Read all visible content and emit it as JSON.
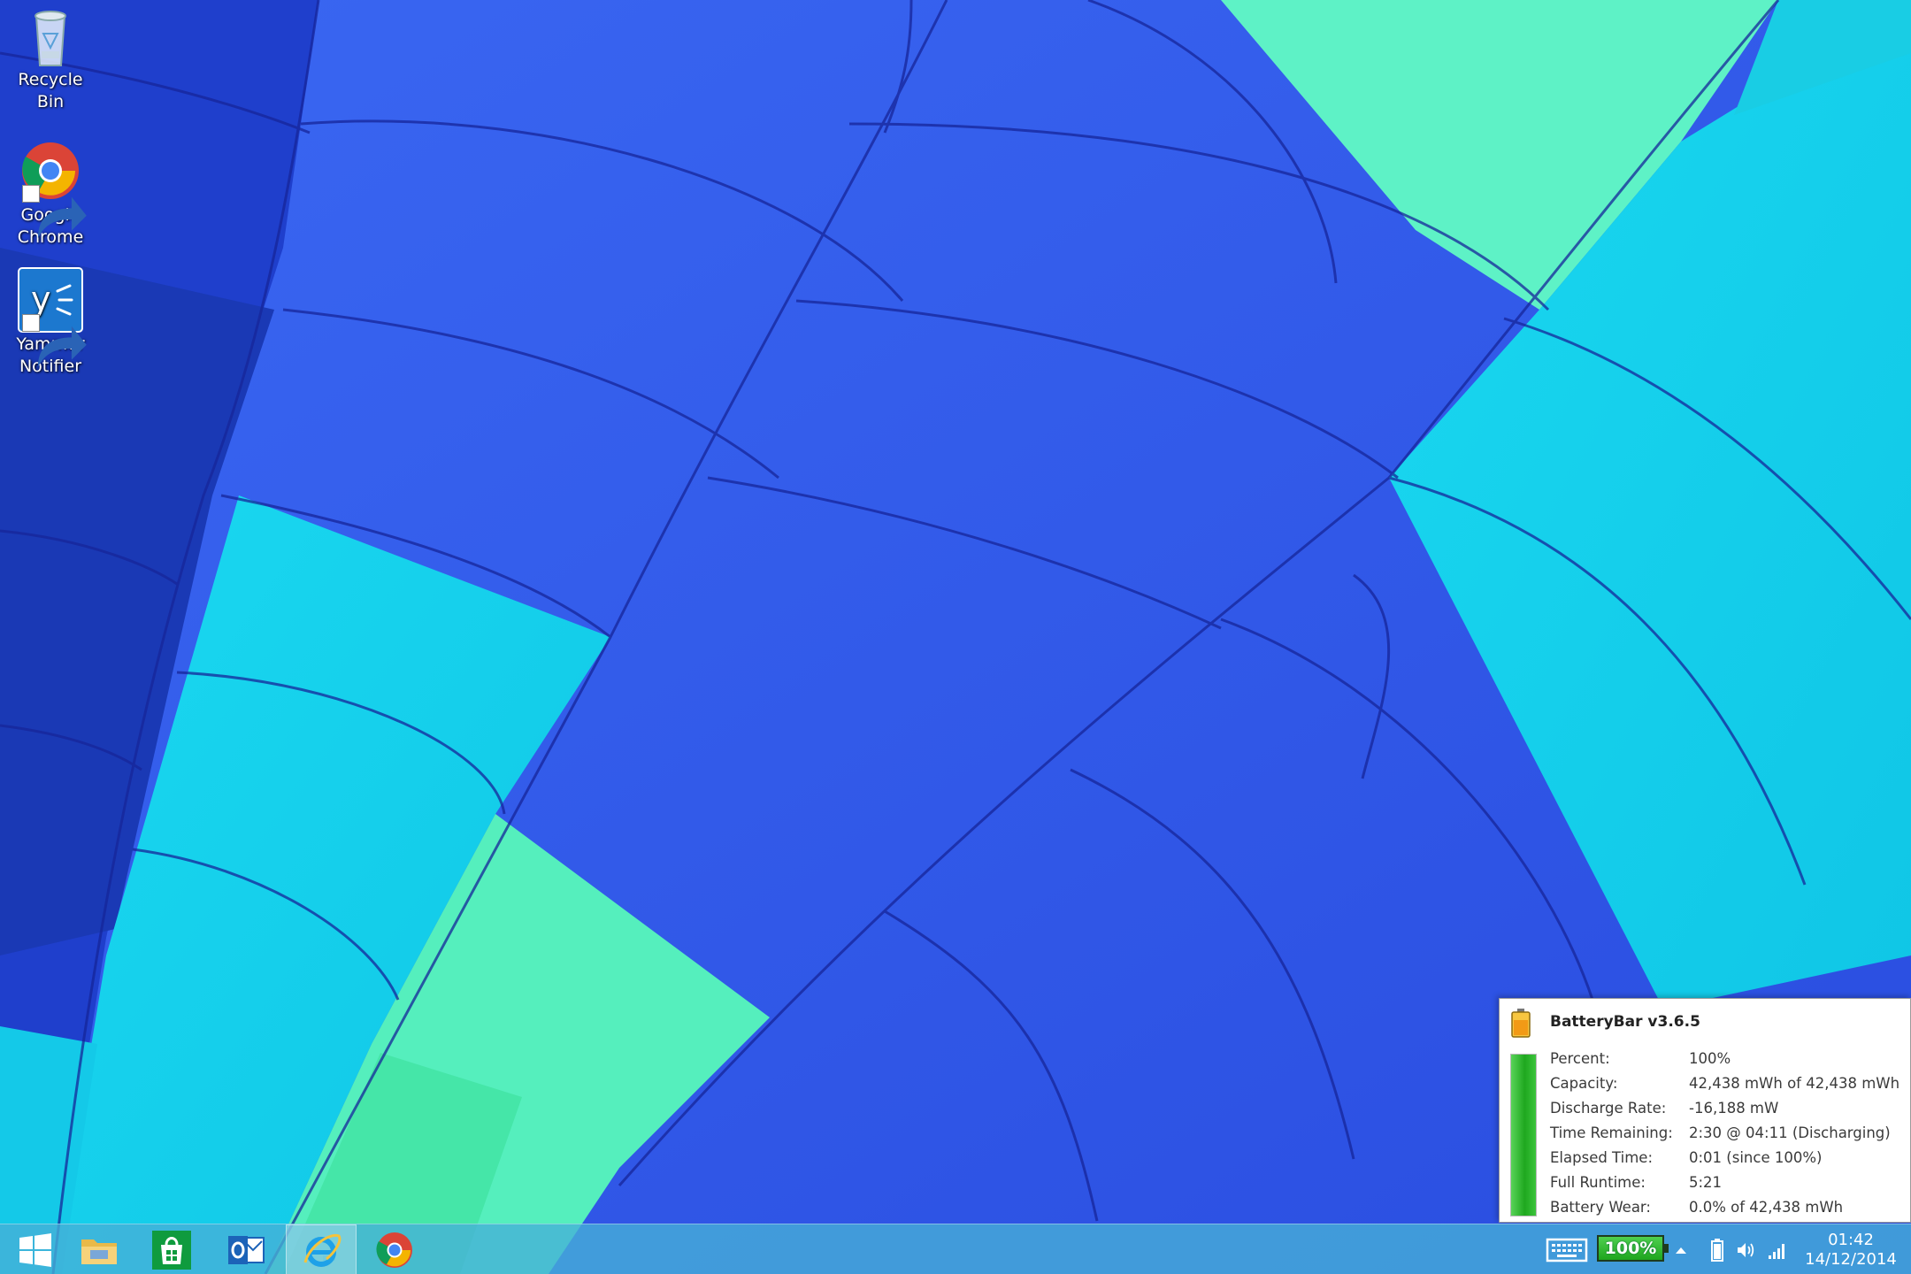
{
  "desktop": {
    "icons": [
      {
        "label": "Recycle Bin",
        "icon": "recycle-bin-icon"
      },
      {
        "label": "Google Chrome",
        "icon": "chrome-icon"
      },
      {
        "label": "Yammer Notifier",
        "icon": "yammer-icon"
      }
    ]
  },
  "taskbar": {
    "pinned": [
      {
        "name": "start",
        "icon": "windows-logo-icon"
      },
      {
        "name": "file-explorer",
        "icon": "folder-icon"
      },
      {
        "name": "store",
        "icon": "store-icon"
      },
      {
        "name": "outlook",
        "icon": "outlook-icon"
      },
      {
        "name": "internet-explorer",
        "icon": "ie-icon",
        "active": true
      },
      {
        "name": "chrome",
        "icon": "chrome-icon"
      }
    ],
    "tray": {
      "battery_percent_label": "100%",
      "battery_level": 1.0,
      "icons": [
        "keyboard-icon",
        "chevron-up-icon",
        "battery-icon",
        "speaker-icon",
        "wifi-signal-icon"
      ]
    },
    "clock": {
      "time": "01:42",
      "date": "14/12/2014"
    }
  },
  "battery_popup": {
    "title": "BatteryBar v3.6.5",
    "charge_level": 1.0,
    "rows": [
      {
        "label": "Percent:",
        "value": "100%"
      },
      {
        "label": "Capacity:",
        "value": "42,438 mWh of 42,438 mWh"
      },
      {
        "label": "Discharge Rate:",
        "value": "-16,188 mW"
      },
      {
        "label": "Time Remaining:",
        "value": "2:30 @ 04:11 (Discharging)"
      },
      {
        "label": "Elapsed Time:",
        "value": "0:01 (since 100%)"
      },
      {
        "label": "Full Runtime:",
        "value": "5:21"
      },
      {
        "label": "Battery Wear:",
        "value": "0.0% of 42,438 mWh"
      }
    ]
  },
  "colors": {
    "wallpaper_blue": "#2f56e8",
    "wallpaper_cyan": "#18dcef",
    "wallpaper_green": "#5cf2c4",
    "battery_green": "#1ea51e"
  }
}
